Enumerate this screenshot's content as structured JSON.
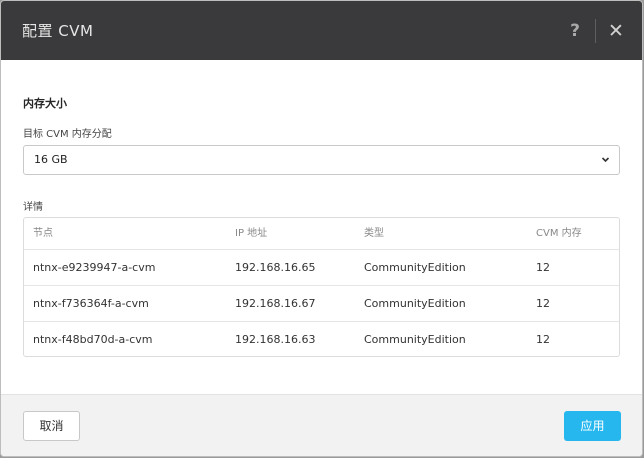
{
  "dialog": {
    "title": "配置 CVM",
    "help_icon": "?",
    "close_icon": "✕"
  },
  "memory": {
    "section_title": "内存大小",
    "target_label": "目标 CVM 内存分配",
    "selected_value": "16 GB",
    "chevron_icon": "chevron-down-icon"
  },
  "details": {
    "label": "详情",
    "columns": [
      "节点",
      "IP 地址",
      "类型",
      "CVM 内存"
    ],
    "rows": [
      [
        "ntnx-e9239947-a-cvm",
        "192.168.16.65",
        "CommunityEdition",
        "12"
      ],
      [
        "ntnx-f736364f-a-cvm",
        "192.168.16.67",
        "CommunityEdition",
        "12"
      ],
      [
        "ntnx-f48bd70d-a-cvm",
        "192.168.16.63",
        "CommunityEdition",
        "12"
      ]
    ]
  },
  "footer": {
    "cancel_label": "取消",
    "apply_label": "应用"
  },
  "colors": {
    "header_bg": "#3a3a3c",
    "apply_bg": "#26b7ef"
  }
}
